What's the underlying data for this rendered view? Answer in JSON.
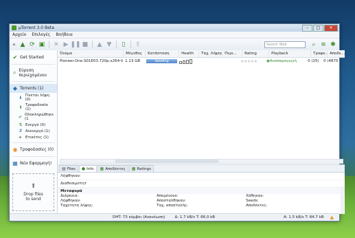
{
  "window": {
    "title": "µTorrent 3.0 Beta",
    "minimize": "–",
    "maximize": "□",
    "close": "✕"
  },
  "menu": [
    "Αρχείο",
    "Επιλογές",
    "Βοήθεια"
  ],
  "search": {
    "placeholder": "Search Web"
  },
  "sidebar": {
    "get_started": "Get Started",
    "find_content": "Εύρεση περιεχομένου",
    "torrents": "Torrents (1)",
    "sub": [
      {
        "label": "Γίνεται λήψη (0)",
        "icon": "download-arrow-icon"
      },
      {
        "label": "Τροφοδοσία (1)",
        "icon": "upload-arrow-icon"
      },
      {
        "label": "Ολοκληρώθηκε (1",
        "icon": "checkmark-icon"
      },
      {
        "label": "Ενεργό (0)",
        "icon": "active-icon"
      },
      {
        "label": "Ανενεργό (1)",
        "icon": "inactive-icon"
      },
      {
        "label": "Ετικέτες (1)",
        "icon": "labels-icon"
      }
    ],
    "feeds": "Τροφοδοσίες (0)",
    "apps": "Νέα Εφαρμογή!",
    "drop_line1": "Drop files",
    "drop_line2": "to send"
  },
  "list": {
    "headers": [
      "Όνομα",
      "Μέγεθος",
      "Κατάσταση",
      "Health",
      "Ταχ. Λήψης",
      "Περι...",
      "Rating",
      "Playback",
      "Τροφο...",
      "Αποδε..."
    ],
    "rows": [
      {
        "name": "Pioneer.One.S01E03.720p.x264-VO...",
        "size": "1.13 GB",
        "status": "Seeding",
        "health": "",
        "down": "",
        "eta": "",
        "rating": "★★★★★",
        "playback": "Αναπαραγωγή",
        "seeds": "0 (25)",
        "peers": "0 (4875"
      }
    ]
  },
  "tabs": [
    "Files",
    "Info",
    "Αποδέκτες",
    "Ratings"
  ],
  "details": {
    "downloaded_label": "Λήφθηκαν:",
    "availability_label": "Διαθεσιμότητ",
    "section": "Μεταφορά",
    "grid": [
      "Διάρκεια:",
      "Απομένουν:",
      "Χάθηκαν:",
      "Λήφθηκαν:",
      "Αποσταλθηκαν:",
      "Seeds:",
      "Ταχύτητα λήψης:",
      "Ταχ. αποστολής:",
      "Αποδέκτες:"
    ]
  },
  "statusbar": {
    "dht": "DHT: 73 κόμβοι (Ανανέωση)",
    "down": "Δ: 1.7 kB/s T: 66.0 kB",
    "up": "Α: 1.5 kB/s T: 64.7 kB"
  },
  "colors": {
    "accent": "#3a8a2a",
    "seeding": "#4f86c8"
  }
}
